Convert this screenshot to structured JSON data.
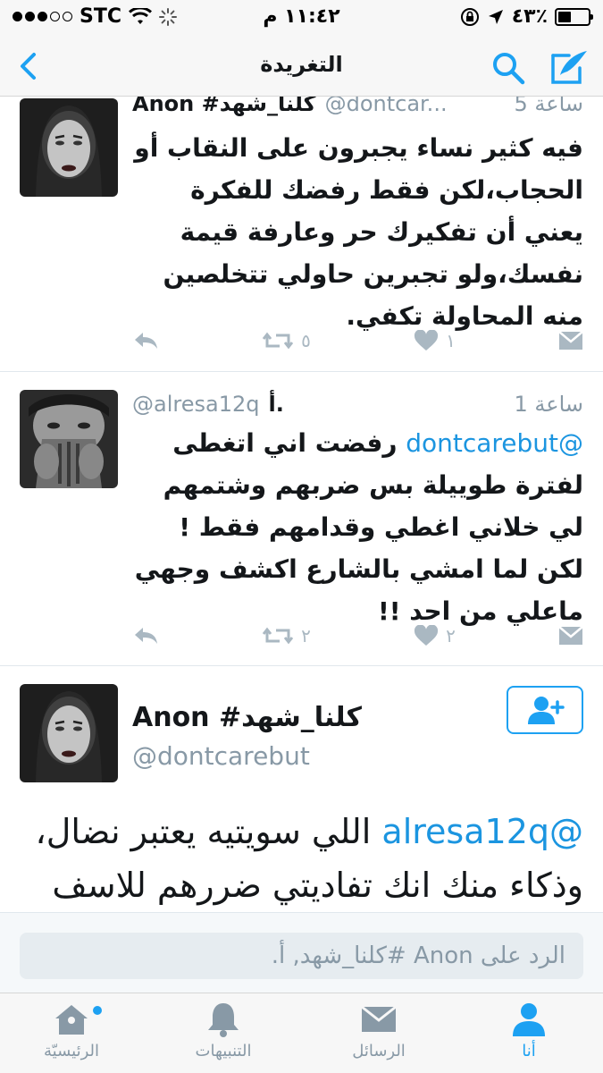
{
  "status_bar": {
    "carrier": "STC",
    "time": "١١:٤٢ م",
    "battery": "٤٣٪",
    "battery_level": 0.43
  },
  "nav": {
    "title": "التغريدة",
    "back_icon": "chevron-left-icon",
    "search_icon": "search-icon",
    "compose_icon": "compose-icon"
  },
  "tweets": [
    {
      "name": "Anon #كلنا_شهد",
      "handle": "@dontcar...",
      "time": "5 ساعة",
      "text": "فيه كثير نساء يجبرون على النقاب أو الحجاب،لكن فقط رفضك للفكرة يعني أن تفكيرك حر وعارفة قيمة نفسك،ولو تجبرين حاولي تتخلصين منه المحاولة تكفي.",
      "retweets": "٥",
      "likes": "١"
    },
    {
      "name": "أ.",
      "handle": "@alresa12q",
      "time": "1 ساعة",
      "mention": "@dontcarebut",
      "text": "رفضت اني اتغطى لفترة طوييلة بس ضربهم وشتمهم لي خلاني اغطي وقدامهم فقط ! لكن لما امشي بالشارع اكشف وجهي ماعلي من احد !!",
      "retweets": "٢",
      "likes": "٢"
    }
  ],
  "detail": {
    "name": "Anon #كلنا_شهد",
    "handle": "@dontcarebut",
    "mention": "@alresa12q",
    "text": "اللي سويتيه يعتبر نضال، وذكاء منك انك تفاديتي ضررهم للاسف"
  },
  "reply": {
    "placeholder": "الرد على Anon #كلنا_شهد, أ."
  },
  "tabs": [
    {
      "label": "الرئيسيّة",
      "icon": "home-icon"
    },
    {
      "label": "التنبيهات",
      "icon": "bell-icon"
    },
    {
      "label": "الرسائل",
      "icon": "envelope-icon"
    },
    {
      "label": "أنا",
      "icon": "person-icon"
    }
  ],
  "colors": {
    "accent": "#1da1f2",
    "link": "#1b95e0",
    "muted": "#8899a6"
  }
}
